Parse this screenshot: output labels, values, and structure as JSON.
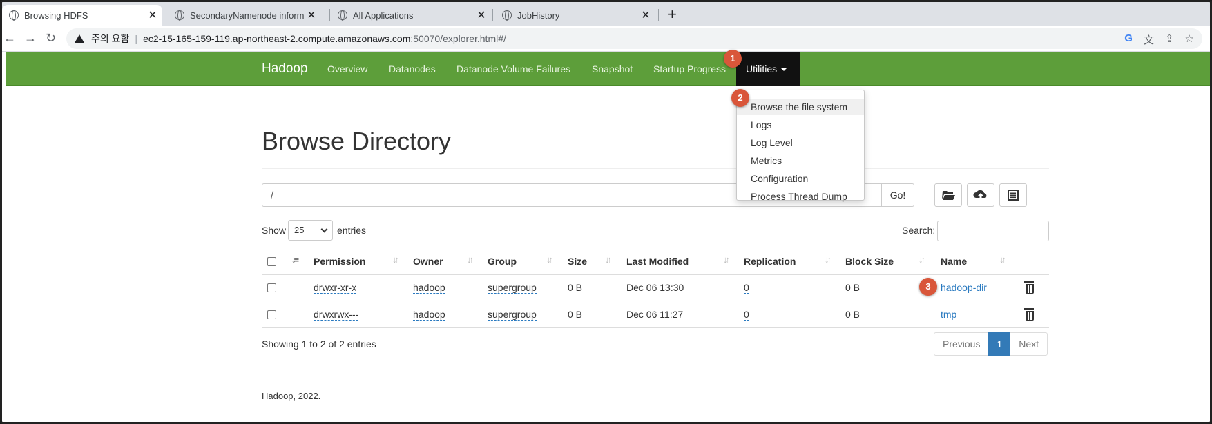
{
  "browser": {
    "tabs": [
      {
        "title": "Browsing HDFS",
        "active": true
      },
      {
        "title": "SecondaryNamenode information",
        "active": false
      },
      {
        "title": "All Applications",
        "active": false
      },
      {
        "title": "JobHistory",
        "active": false
      }
    ],
    "new_tab": "+",
    "close_glyph": "✕",
    "security_warning": "주의 요함",
    "url_host": "ec2-15-165-159-119.ap-northeast-2.compute.amazonaws.com",
    "url_path": ":50070/explorer.html#/"
  },
  "navbar": {
    "brand": "Hadoop",
    "links": [
      "Overview",
      "Datanodes",
      "Datanode Volume Failures",
      "Snapshot",
      "Startup Progress"
    ],
    "utilities": "Utilities"
  },
  "dropdown": {
    "items": [
      "Browse the file system",
      "Logs",
      "Log Level",
      "Metrics",
      "Configuration",
      "Process Thread Dump"
    ]
  },
  "markers": [
    "1",
    "2",
    "3"
  ],
  "page": {
    "title": "Browse Directory",
    "path_value": "/",
    "go_label": "Go!",
    "show_label": "Show",
    "entries_value": "25",
    "entries_label": "entries",
    "search_label": "Search:"
  },
  "table": {
    "columns": [
      "Permission",
      "Owner",
      "Group",
      "Size",
      "Last Modified",
      "Replication",
      "Block Size",
      "Name"
    ],
    "rows": [
      {
        "permission": "drwxr-xr-x",
        "owner": "hadoop",
        "group": "supergroup",
        "size": "0 B",
        "modified": "Dec 06 13:30",
        "replication": "0",
        "block_size": "0 B",
        "name": "hadoop-dir"
      },
      {
        "permission": "drwxrwx---",
        "owner": "hadoop",
        "group": "supergroup",
        "size": "0 B",
        "modified": "Dec 06 11:27",
        "replication": "0",
        "block_size": "0 B",
        "name": "tmp"
      }
    ]
  },
  "pagination": {
    "info": "Showing 1 to 2 of 2 entries",
    "previous": "Previous",
    "current": "1",
    "next": "Next"
  },
  "footer": "Hadoop, 2022.",
  "colors": {
    "navbar": "#5d9e3a",
    "marker": "#d9563a",
    "link": "#2a7ac0",
    "active_page": "#337ab7"
  }
}
